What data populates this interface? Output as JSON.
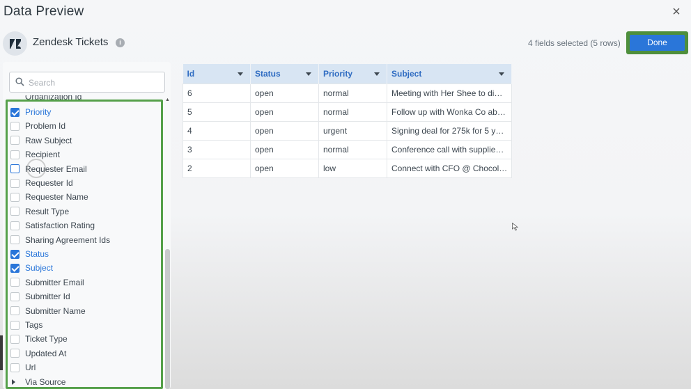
{
  "window": {
    "title": "Data Preview",
    "close_glyph": "×"
  },
  "source": {
    "logo_icon": "zendesk-logo",
    "name": "Zendesk Tickets",
    "info_glyph": "i"
  },
  "header": {
    "fields_selected": "4 fields selected (5 rows)",
    "done_label": "Done"
  },
  "search": {
    "placeholder": "Search",
    "value": ""
  },
  "field_list": {
    "cut_off_item": "Organization Id",
    "items": [
      {
        "label": "Priority",
        "checked": true
      },
      {
        "label": "Problem Id",
        "checked": false
      },
      {
        "label": "Raw Subject",
        "checked": false
      },
      {
        "label": "Recipient",
        "checked": false
      },
      {
        "label": "Requester Email",
        "checked": false
      },
      {
        "label": "Requester Id",
        "checked": false
      },
      {
        "label": "Requester Name",
        "checked": false
      },
      {
        "label": "Result Type",
        "checked": false
      },
      {
        "label": "Satisfaction Rating",
        "checked": false
      },
      {
        "label": "Sharing Agreement Ids",
        "checked": false
      },
      {
        "label": "Status",
        "checked": true
      },
      {
        "label": "Subject",
        "checked": true
      },
      {
        "label": "Submitter Email",
        "checked": false
      },
      {
        "label": "Submitter Id",
        "checked": false
      },
      {
        "label": "Submitter Name",
        "checked": false
      },
      {
        "label": "Tags",
        "checked": false
      },
      {
        "label": "Ticket Type",
        "checked": false
      },
      {
        "label": "Updated At",
        "checked": false
      },
      {
        "label": "Url",
        "checked": false
      },
      {
        "label": "Via Source",
        "expandable": true
      }
    ]
  },
  "table": {
    "columns": [
      "Id",
      "Status",
      "Priority",
      "Subject"
    ],
    "rows": [
      [
        "6",
        "open",
        "normal",
        "Meeting with Her Shee to di…"
      ],
      [
        "5",
        "open",
        "normal",
        "Follow up with Wonka Co ab…"
      ],
      [
        "4",
        "open",
        "urgent",
        "Signing deal for 275k for 5 y…"
      ],
      [
        "3",
        "open",
        "normal",
        "Conference call with supplie…"
      ],
      [
        "2",
        "open",
        "low",
        "Connect with CFO @ Chocol…"
      ]
    ]
  },
  "colors": {
    "accent": "#2a76d9",
    "highlight_border": "#55a04a",
    "header_bg": "#d8e5f3"
  }
}
